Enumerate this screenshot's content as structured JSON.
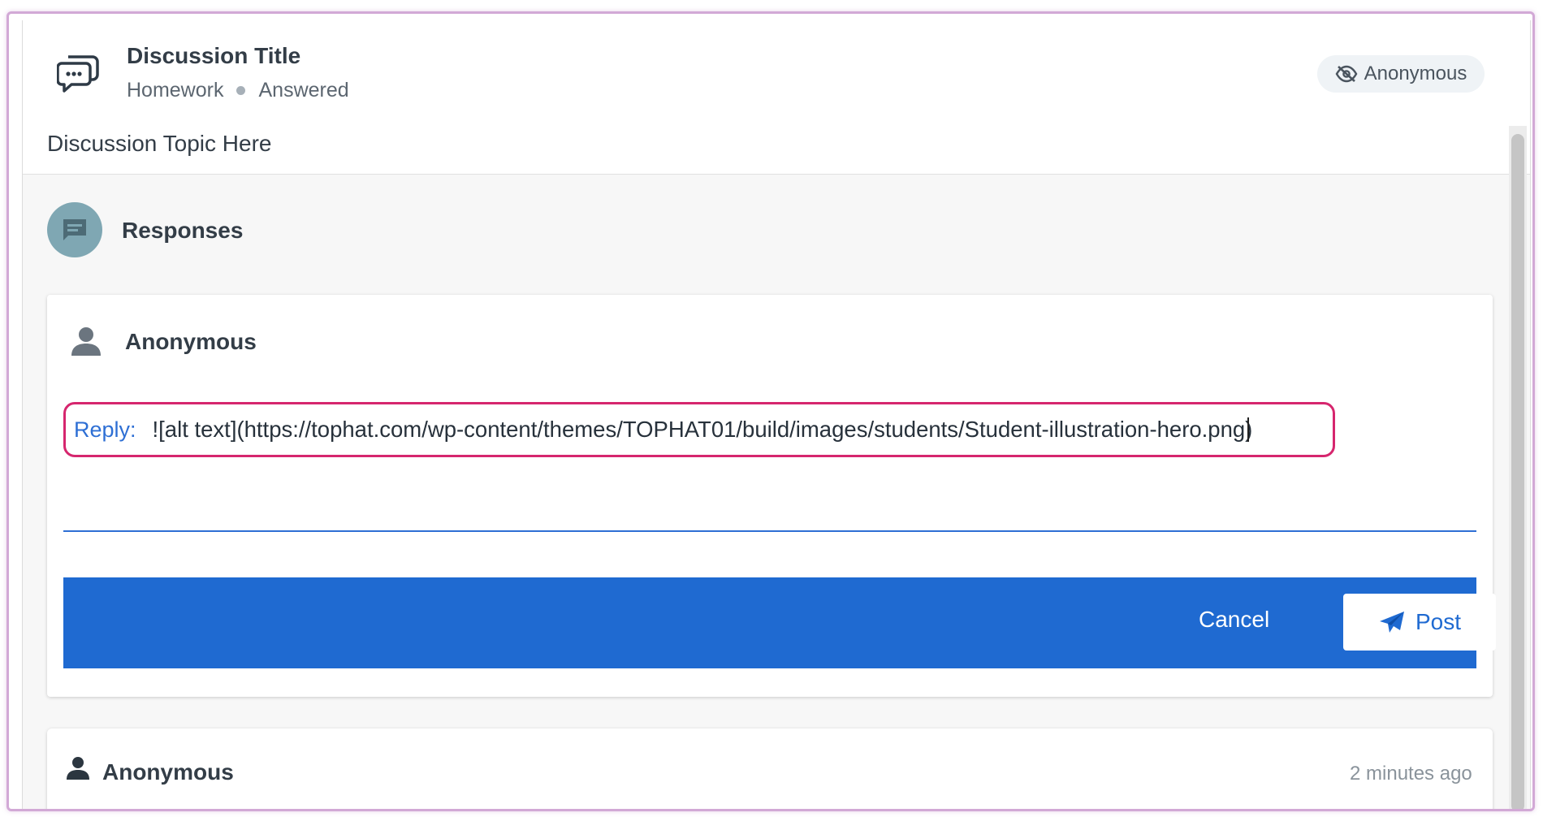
{
  "header": {
    "title": "Discussion Title",
    "meta": [
      "Homework",
      "Answered"
    ],
    "anonymous_label": "Anonymous",
    "topic": "Discussion Topic Here"
  },
  "responses": {
    "title": "Responses"
  },
  "reply_card": {
    "user": "Anonymous",
    "reply_label": "Reply:",
    "reply_value": "![alt text](https://tophat.com/wp-content/themes/TOPHAT01/build/images/students/Student-illustration-hero.png)",
    "cancel_label": "Cancel",
    "post_label": "Post"
  },
  "response_item": {
    "user": "Anonymous",
    "time": "2 minutes ago"
  },
  "colors": {
    "accent": "#1f6ad1",
    "highlight": "#d6266e",
    "avatar": "#7fa7b3"
  }
}
